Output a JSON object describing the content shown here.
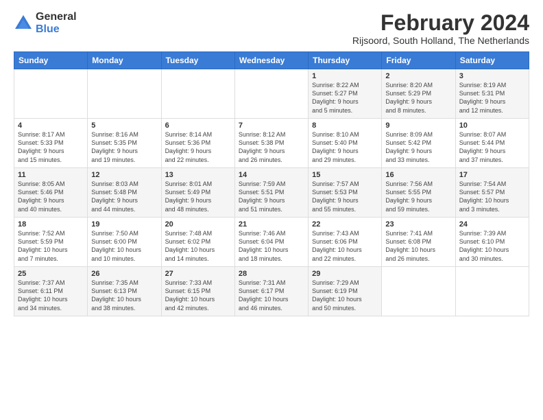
{
  "logo": {
    "general": "General",
    "blue": "Blue"
  },
  "title": "February 2024",
  "location": "Rijsoord, South Holland, The Netherlands",
  "days_of_week": [
    "Sunday",
    "Monday",
    "Tuesday",
    "Wednesday",
    "Thursday",
    "Friday",
    "Saturday"
  ],
  "weeks": [
    [
      {
        "day": "",
        "info": ""
      },
      {
        "day": "",
        "info": ""
      },
      {
        "day": "",
        "info": ""
      },
      {
        "day": "",
        "info": ""
      },
      {
        "day": "1",
        "info": "Sunrise: 8:22 AM\nSunset: 5:27 PM\nDaylight: 9 hours\nand 5 minutes."
      },
      {
        "day": "2",
        "info": "Sunrise: 8:20 AM\nSunset: 5:29 PM\nDaylight: 9 hours\nand 8 minutes."
      },
      {
        "day": "3",
        "info": "Sunrise: 8:19 AM\nSunset: 5:31 PM\nDaylight: 9 hours\nand 12 minutes."
      }
    ],
    [
      {
        "day": "4",
        "info": "Sunrise: 8:17 AM\nSunset: 5:33 PM\nDaylight: 9 hours\nand 15 minutes."
      },
      {
        "day": "5",
        "info": "Sunrise: 8:16 AM\nSunset: 5:35 PM\nDaylight: 9 hours\nand 19 minutes."
      },
      {
        "day": "6",
        "info": "Sunrise: 8:14 AM\nSunset: 5:36 PM\nDaylight: 9 hours\nand 22 minutes."
      },
      {
        "day": "7",
        "info": "Sunrise: 8:12 AM\nSunset: 5:38 PM\nDaylight: 9 hours\nand 26 minutes."
      },
      {
        "day": "8",
        "info": "Sunrise: 8:10 AM\nSunset: 5:40 PM\nDaylight: 9 hours\nand 29 minutes."
      },
      {
        "day": "9",
        "info": "Sunrise: 8:09 AM\nSunset: 5:42 PM\nDaylight: 9 hours\nand 33 minutes."
      },
      {
        "day": "10",
        "info": "Sunrise: 8:07 AM\nSunset: 5:44 PM\nDaylight: 9 hours\nand 37 minutes."
      }
    ],
    [
      {
        "day": "11",
        "info": "Sunrise: 8:05 AM\nSunset: 5:46 PM\nDaylight: 9 hours\nand 40 minutes."
      },
      {
        "day": "12",
        "info": "Sunrise: 8:03 AM\nSunset: 5:48 PM\nDaylight: 9 hours\nand 44 minutes."
      },
      {
        "day": "13",
        "info": "Sunrise: 8:01 AM\nSunset: 5:49 PM\nDaylight: 9 hours\nand 48 minutes."
      },
      {
        "day": "14",
        "info": "Sunrise: 7:59 AM\nSunset: 5:51 PM\nDaylight: 9 hours\nand 51 minutes."
      },
      {
        "day": "15",
        "info": "Sunrise: 7:57 AM\nSunset: 5:53 PM\nDaylight: 9 hours\nand 55 minutes."
      },
      {
        "day": "16",
        "info": "Sunrise: 7:56 AM\nSunset: 5:55 PM\nDaylight: 9 hours\nand 59 minutes."
      },
      {
        "day": "17",
        "info": "Sunrise: 7:54 AM\nSunset: 5:57 PM\nDaylight: 10 hours\nand 3 minutes."
      }
    ],
    [
      {
        "day": "18",
        "info": "Sunrise: 7:52 AM\nSunset: 5:59 PM\nDaylight: 10 hours\nand 7 minutes."
      },
      {
        "day": "19",
        "info": "Sunrise: 7:50 AM\nSunset: 6:00 PM\nDaylight: 10 hours\nand 10 minutes."
      },
      {
        "day": "20",
        "info": "Sunrise: 7:48 AM\nSunset: 6:02 PM\nDaylight: 10 hours\nand 14 minutes."
      },
      {
        "day": "21",
        "info": "Sunrise: 7:46 AM\nSunset: 6:04 PM\nDaylight: 10 hours\nand 18 minutes."
      },
      {
        "day": "22",
        "info": "Sunrise: 7:43 AM\nSunset: 6:06 PM\nDaylight: 10 hours\nand 22 minutes."
      },
      {
        "day": "23",
        "info": "Sunrise: 7:41 AM\nSunset: 6:08 PM\nDaylight: 10 hours\nand 26 minutes."
      },
      {
        "day": "24",
        "info": "Sunrise: 7:39 AM\nSunset: 6:10 PM\nDaylight: 10 hours\nand 30 minutes."
      }
    ],
    [
      {
        "day": "25",
        "info": "Sunrise: 7:37 AM\nSunset: 6:11 PM\nDaylight: 10 hours\nand 34 minutes."
      },
      {
        "day": "26",
        "info": "Sunrise: 7:35 AM\nSunset: 6:13 PM\nDaylight: 10 hours\nand 38 minutes."
      },
      {
        "day": "27",
        "info": "Sunrise: 7:33 AM\nSunset: 6:15 PM\nDaylight: 10 hours\nand 42 minutes."
      },
      {
        "day": "28",
        "info": "Sunrise: 7:31 AM\nSunset: 6:17 PM\nDaylight: 10 hours\nand 46 minutes."
      },
      {
        "day": "29",
        "info": "Sunrise: 7:29 AM\nSunset: 6:19 PM\nDaylight: 10 hours\nand 50 minutes."
      },
      {
        "day": "",
        "info": ""
      },
      {
        "day": "",
        "info": ""
      }
    ]
  ]
}
